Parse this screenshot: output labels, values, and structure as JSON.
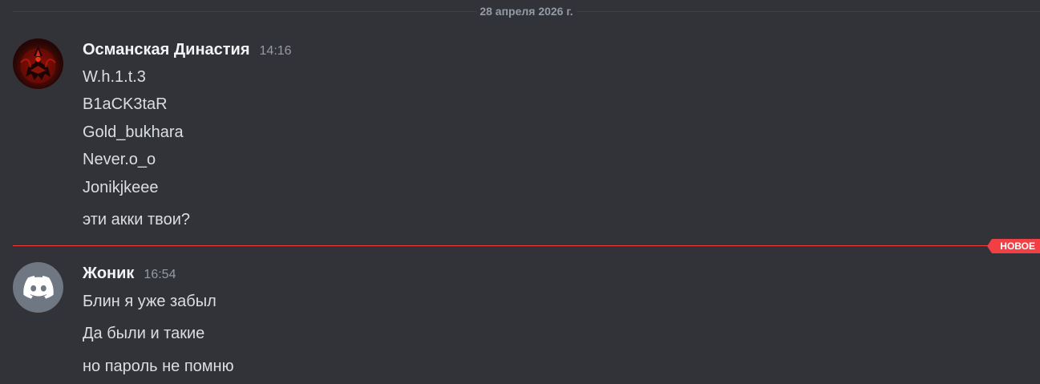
{
  "date_divider": "28 апреля 2026 г.",
  "new_divider": "НОВОЕ",
  "messages": [
    {
      "username": "Османская Династия",
      "timestamp": "14:16",
      "avatar": "dark-red-figure-avatar",
      "lines": [
        "W.h.1.t.3",
        "B1aCK3taR",
        "Gold_bukhara",
        "Never.o_o",
        "Jonikjkeee",
        "эти акки твои?"
      ]
    },
    {
      "username": "Жоник",
      "timestamp": "16:54",
      "avatar": "discord-logo-icon",
      "lines": [
        "Блин я уже забыл",
        "Да были и такие",
        "но пароль не помню"
      ]
    }
  ],
  "colors": {
    "background": "#323339",
    "username": "#f2f3f5",
    "text": "#dbdee1",
    "muted": "#949ba4",
    "new_accent": "#f23f43",
    "default_avatar": "#6f7782"
  }
}
